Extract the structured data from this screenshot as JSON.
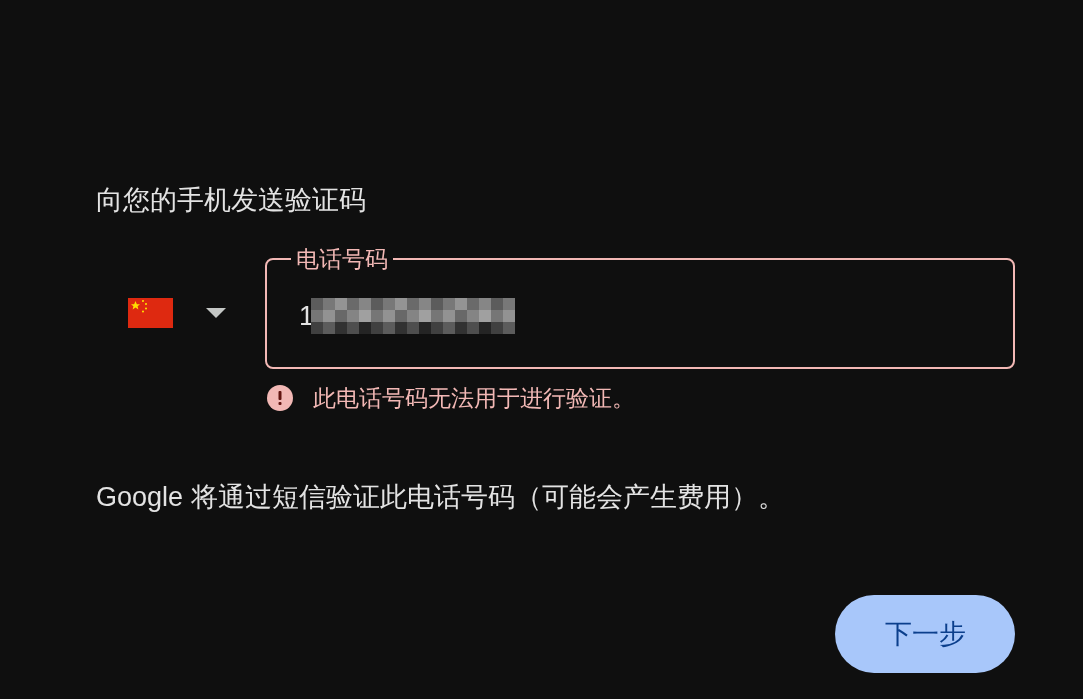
{
  "heading": "向您的手机发送验证码",
  "phone_field": {
    "label": "电话号码",
    "value": "1",
    "redacted": true,
    "error": true
  },
  "error_message": "此电话号码无法用于进行验证。",
  "notice": "Google 将通过短信验证此电话号码（可能会产生费用）。",
  "buttons": [
    {
      "label": "下一步",
      "kind": "primary"
    }
  ]
}
